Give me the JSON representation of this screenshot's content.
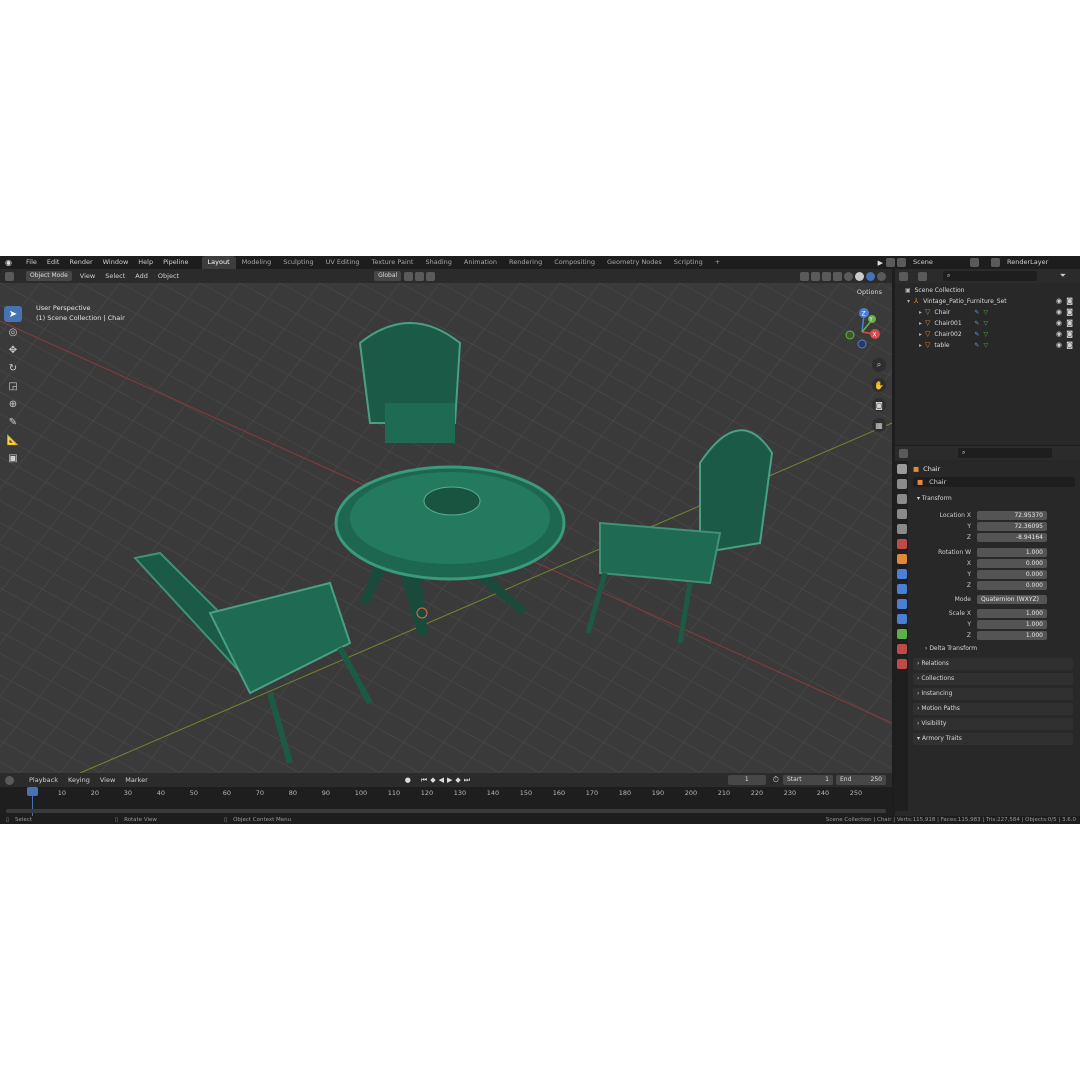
{
  "menubar": {
    "items": [
      "File",
      "Edit",
      "Render",
      "Window",
      "Help",
      "Pipeline"
    ],
    "workspaces": [
      "Layout",
      "Modeling",
      "Sculpting",
      "UV Editing",
      "Texture Paint",
      "Shading",
      "Animation",
      "Rendering",
      "Compositing",
      "Geometry Nodes",
      "Scripting"
    ],
    "active_workspace": "Layout",
    "add_tab": "+",
    "scene": "Scene",
    "view_layer": "RenderLayer"
  },
  "viewport": {
    "mode": "Object Mode",
    "menus": [
      "View",
      "Select",
      "Add",
      "Object"
    ],
    "orientation": "Global",
    "overlay_line1": "User Perspective",
    "overlay_line2": "(1) Scene Collection | Chair",
    "options": "Options"
  },
  "gizmo": {
    "z": "Z",
    "y": "Y",
    "x": "X"
  },
  "timeline": {
    "menus": [
      "Playback",
      "Keying",
      "View",
      "Marker"
    ],
    "current_frame": "1",
    "start_label": "Start",
    "start": "1",
    "end_label": "End",
    "end": "250",
    "ticks": [
      "1",
      "10",
      "20",
      "30",
      "40",
      "50",
      "60",
      "70",
      "80",
      "90",
      "100",
      "110",
      "120",
      "130",
      "140",
      "150",
      "160",
      "170",
      "180",
      "190",
      "200",
      "210",
      "220",
      "230",
      "240",
      "250"
    ]
  },
  "status": {
    "select": "Select",
    "rotate": "Rotate View",
    "context": "Object Context Menu",
    "stats": "Scene Collection | Chair | Verts:115,918 | Faces:115,983 | Tris:227,584 | Objects:0/5 | 3.6.0"
  },
  "outliner": {
    "root": "Scene Collection",
    "collection": "Vintage_Patio_Furniture_Set",
    "objects": [
      "Chair",
      "Chair001",
      "Chair002",
      "table"
    ]
  },
  "properties": {
    "object_name": "Chair",
    "datablock": "Chair",
    "transform_title": "Transform",
    "location_label": "Location X",
    "location": [
      "72.95370",
      "72.36095",
      "-8.94164"
    ],
    "rotation_label": "Rotation W",
    "rotation": [
      "1.000",
      "0.000",
      "0.000",
      "0.000"
    ],
    "axis_labels": [
      "Y",
      "Z",
      "X",
      "Y",
      "Z"
    ],
    "mode_label": "Mode",
    "mode_value": "Quaternion (WXYZ)",
    "scale_label": "Scale X",
    "scale": [
      "1.000",
      "1.000",
      "1.000"
    ],
    "subpanels": [
      "Delta Transform",
      "Relations",
      "Collections",
      "Instancing",
      "Motion Paths",
      "Visibility",
      "Armory Traits"
    ]
  },
  "colors": {
    "accent": "#4772b3",
    "object_orange": "#e08a3a",
    "mesh_green": "#1f6b55"
  }
}
